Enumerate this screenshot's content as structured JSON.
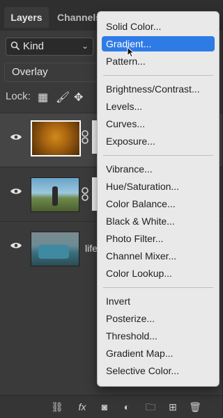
{
  "tabs": {
    "layers": "Layers",
    "channels": "Channels"
  },
  "filter": {
    "label": "Kind"
  },
  "blend_mode": "Overlay",
  "lock": {
    "label": "Lock:"
  },
  "layers": [
    {
      "name": ""
    },
    {
      "name": ""
    },
    {
      "name": "life"
    }
  ],
  "menu": {
    "group1": [
      "Solid Color...",
      "Gradient...",
      "Pattern..."
    ],
    "group2": [
      "Brightness/Contrast...",
      "Levels...",
      "Curves...",
      "Exposure..."
    ],
    "group3": [
      "Vibrance...",
      "Hue/Saturation...",
      "Color Balance...",
      "Black & White...",
      "Photo Filter...",
      "Channel Mixer...",
      "Color Lookup..."
    ],
    "group4": [
      "Invert",
      "Posterize...",
      "Threshold...",
      "Gradient Map...",
      "Selective Color..."
    ]
  },
  "bottom_bar": {
    "fx": "fx"
  },
  "colors": {
    "highlight": "#2f7be6",
    "menu_bg": "#e9e9e9",
    "panel_bg": "#3a3a3a"
  }
}
